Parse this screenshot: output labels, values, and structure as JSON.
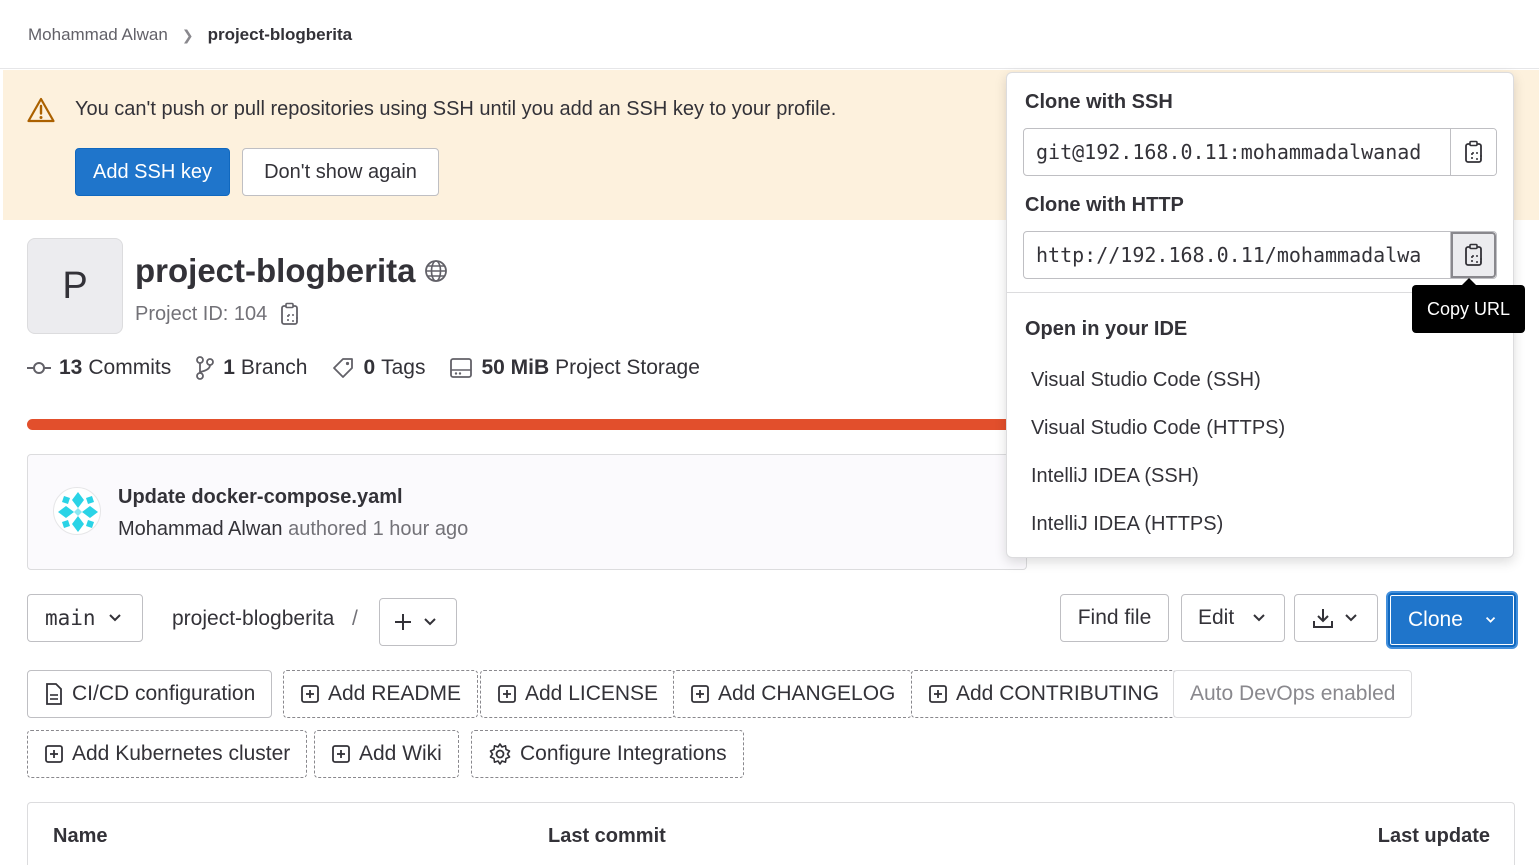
{
  "breadcrumb": {
    "owner": "Mohammad Alwan",
    "project": "project-blogberita"
  },
  "banner": {
    "message": "You can't push or pull repositories using SSH until you add an SSH key to your profile.",
    "add_key_label": "Add SSH key",
    "dismiss_label": "Don't show again"
  },
  "project": {
    "avatar_letter": "P",
    "name": "project-blogberita",
    "id_text": "Project ID: 104"
  },
  "stats": {
    "commits_count": "13",
    "commits_label": "Commits",
    "branch_count": "1",
    "branch_label": "Branch",
    "tags_count": "0",
    "tags_label": "Tags",
    "storage_size": "50 MiB",
    "storage_label": "Project Storage"
  },
  "commit": {
    "title": "Update docker-compose.yaml",
    "author": "Mohammad Alwan",
    "meta": "authored 1 hour ago"
  },
  "toolbar": {
    "branch": "main",
    "path": "project-blogberita",
    "path_sep": "/",
    "find_file": "Find file",
    "edit": "Edit",
    "clone": "Clone"
  },
  "quick_actions": {
    "cicd": "CI/CD configuration",
    "readme": "Add README",
    "license": "Add LICENSE",
    "changelog": "Add CHANGELOG",
    "contributing": "Add CONTRIBUTING",
    "autodevops": "Auto DevOps enabled",
    "kubernetes": "Add Kubernetes cluster",
    "wiki": "Add Wiki",
    "integrations": "Configure Integrations"
  },
  "table": {
    "col_name": "Name",
    "col_last_commit": "Last commit",
    "col_last_update": "Last update"
  },
  "clone_dropdown": {
    "ssh_label": "Clone with SSH",
    "ssh_url": "git@192.168.0.11:mohammadalwanad",
    "http_label": "Clone with HTTP",
    "http_url": "http://192.168.0.11/mohammadalwa",
    "ide_label": "Open in your IDE",
    "ide_items": [
      "Visual Studio Code (SSH)",
      "Visual Studio Code (HTTPS)",
      "IntelliJ IDEA (SSH)",
      "IntelliJ IDEA (HTTPS)"
    ],
    "tooltip": "Copy URL"
  },
  "colors": {
    "primary": "#1f75cb",
    "banner_bg": "#fdf1dd",
    "storage_bar": "#e24f2c",
    "warning": "#ab6100"
  }
}
